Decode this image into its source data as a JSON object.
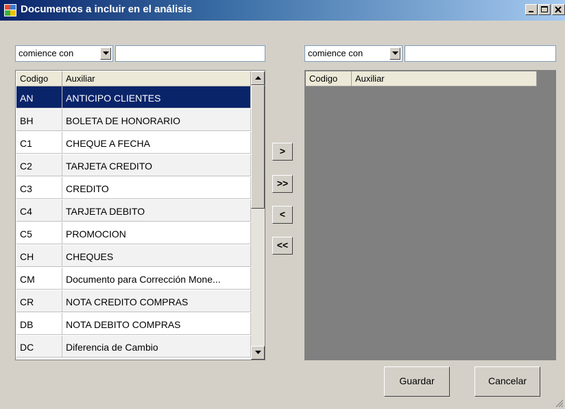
{
  "window": {
    "title": "Documentos a incluir en el análisis",
    "icon": "app-window-icon",
    "controls": [
      "minimize-icon",
      "maximize-icon",
      "close-icon"
    ]
  },
  "left_panel": {
    "filter_mode": "comience con",
    "filter_text": "",
    "columns": [
      "Codigo",
      "Auxiliar"
    ],
    "selected_index": 0,
    "rows": [
      {
        "codigo": "AN",
        "auxiliar": "ANTICIPO CLIENTES"
      },
      {
        "codigo": "BH",
        "auxiliar": "BOLETA DE HONORARIO"
      },
      {
        "codigo": "C1",
        "auxiliar": "CHEQUE A FECHA"
      },
      {
        "codigo": "C2",
        "auxiliar": "TARJETA CREDITO"
      },
      {
        "codigo": "C3",
        "auxiliar": "CREDITO"
      },
      {
        "codigo": "C4",
        "auxiliar": "TARJETA DEBITO"
      },
      {
        "codigo": "C5",
        "auxiliar": "PROMOCION"
      },
      {
        "codigo": "CH",
        "auxiliar": "CHEQUES"
      },
      {
        "codigo": "CM",
        "auxiliar": "Documento para Corrección Mone..."
      },
      {
        "codigo": "CR",
        "auxiliar": "NOTA CREDITO COMPRAS"
      },
      {
        "codigo": "DB",
        "auxiliar": "NOTA DEBITO COMPRAS"
      },
      {
        "codigo": "DC",
        "auxiliar": "Diferencia de Cambio"
      }
    ]
  },
  "right_panel": {
    "filter_mode": "comience con",
    "filter_text": "",
    "columns": [
      "Codigo",
      "Auxiliar"
    ],
    "rows": []
  },
  "move_buttons": {
    "add_one": ">",
    "add_all": ">>",
    "remove_one": "<",
    "remove_all": "<<"
  },
  "actions": {
    "save": "Guardar",
    "cancel": "Cancelar"
  },
  "colors": {
    "selection": "#0a246a",
    "titlebar_start": "#0a246a",
    "titlebar_end": "#a6caf0",
    "face": "#d4d0c8",
    "empty_grid": "#808080"
  }
}
